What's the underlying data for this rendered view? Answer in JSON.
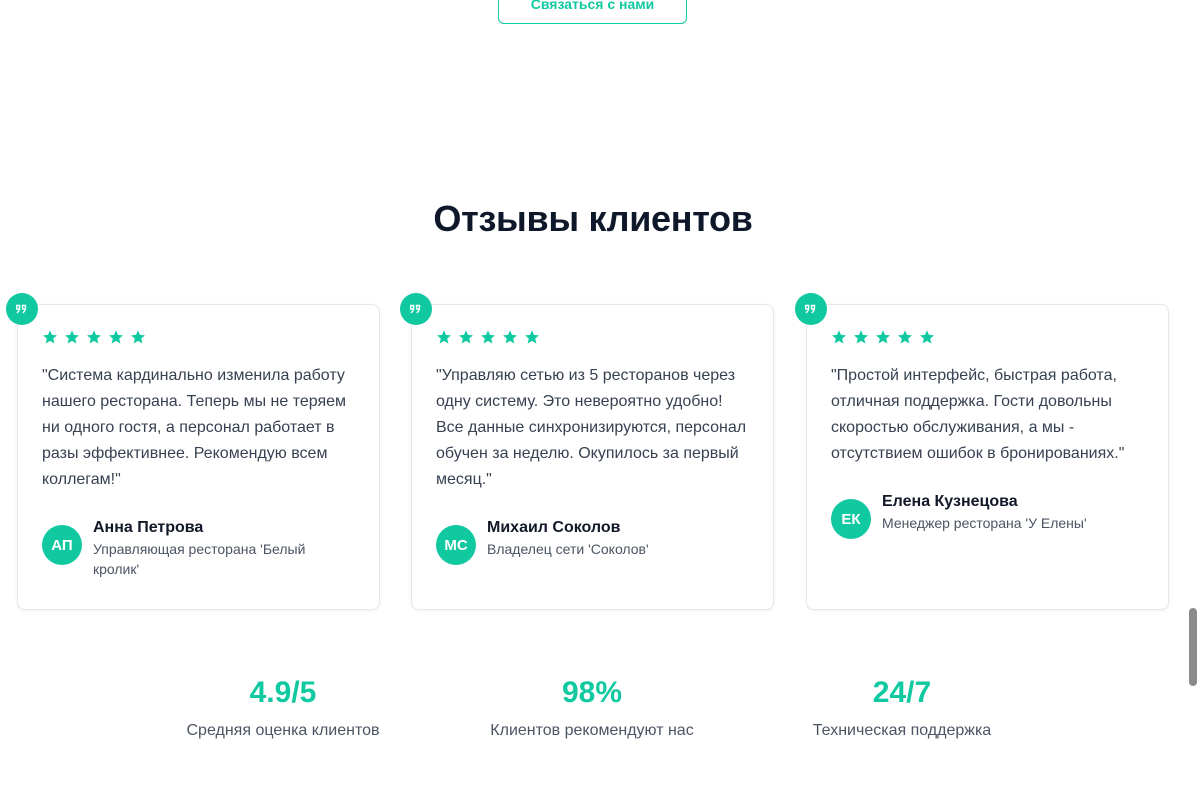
{
  "header": {
    "contact_button_label": "Связаться с нами"
  },
  "section": {
    "title": "Отзывы клиентов"
  },
  "reviews": [
    {
      "rating": 5,
      "text": "\"Система кардинально изменила работу нашего ресторана. Теперь мы не теряем ни одного гостя, а персонал работает в разы эффективнее. Рекомендую всем коллегам!\"",
      "initials": "АП",
      "name": "Анна Петрова",
      "role": "Управляющая ресторана 'Белый кролик'"
    },
    {
      "rating": 5,
      "text": "\"Управляю сетью из 5 ресторанов через одну систему. Это невероятно удобно! Все данные синхронизируются, персонал обучен за неделю. Окупилось за первый месяц.\"",
      "initials": "МС",
      "name": "Михаил Соколов",
      "role": "Владелец сети 'Соколов'"
    },
    {
      "rating": 5,
      "text": "\"Простой интерфейс, быстрая работа, отличная поддержка. Гости довольны скоростью обслуживания, а мы - отсутствием ошибок в бронированиях.\"",
      "initials": "ЕК",
      "name": "Елена Кузнецова",
      "role": "Менеджер ресторана 'У Елены'"
    }
  ],
  "stats": [
    {
      "value": "4.9/5",
      "label": "Средняя оценка клиентов"
    },
    {
      "value": "98%",
      "label": "Клиентов рекомендуют нас"
    },
    {
      "value": "24/7",
      "label": "Техническая поддержка"
    }
  ],
  "icons": {
    "quote": "quote-icon",
    "star": "star-icon"
  },
  "colors": {
    "accent": "#10c9a0",
    "heading": "#0f172a",
    "text": "#374151"
  }
}
